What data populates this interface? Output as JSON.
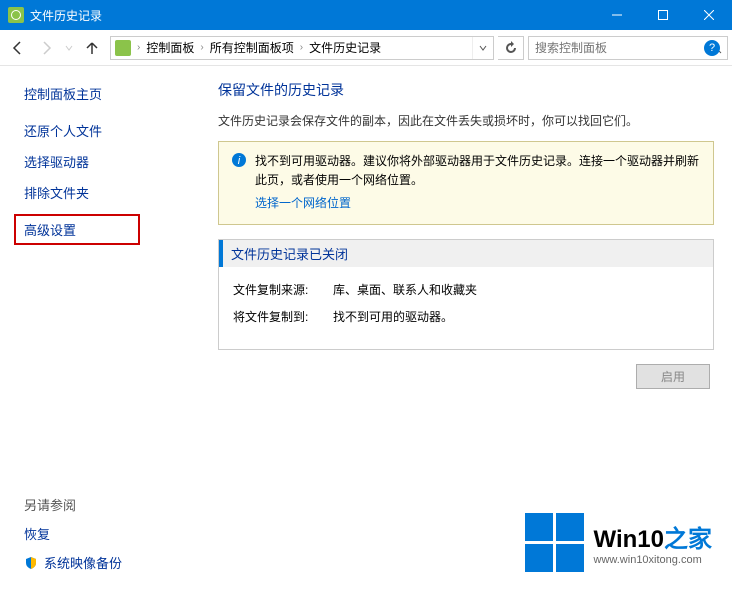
{
  "window": {
    "title": "文件历史记录"
  },
  "breadcrumb": {
    "items": [
      "控制面板",
      "所有控制面板项",
      "文件历史记录"
    ]
  },
  "search": {
    "placeholder": "搜索控制面板"
  },
  "sidebar": {
    "home": "控制面板主页",
    "links": [
      "还原个人文件",
      "选择驱动器",
      "排除文件夹",
      "高级设置"
    ],
    "footer_header": "另请参阅",
    "footer_links": [
      "恢复",
      "系统映像备份"
    ]
  },
  "main": {
    "heading": "保留文件的历史记录",
    "desc": "文件历史记录会保存文件的副本，因此在文件丢失或损坏时，你可以找回它们。",
    "info_text": "找不到可用驱动器。建议你将外部驱动器用于文件历史记录。连接一个驱动器并刷新此页，或者使用一个网络位置。",
    "info_link": "选择一个网络位置",
    "status_title": "文件历史记录已关闭",
    "rows": [
      {
        "label": "文件复制来源:",
        "value": "库、桌面、联系人和收藏夹"
      },
      {
        "label": "将文件复制到:",
        "value": "找不到可用的驱动器。"
      }
    ],
    "enable_btn": "启用"
  },
  "watermark": {
    "title_a": "Win10",
    "title_b": "之家",
    "url": "www.win10xitong.com"
  }
}
